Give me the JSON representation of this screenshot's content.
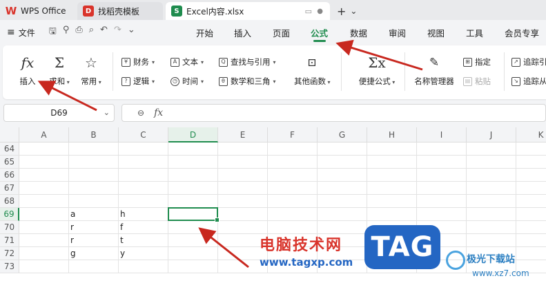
{
  "titlebar": {
    "tabs": [
      {
        "label": "WPS Office",
        "logo": "W"
      },
      {
        "label": "找稻壳模板",
        "logo": "D"
      },
      {
        "label": "Excel内容.xlsx",
        "logo": "S"
      }
    ],
    "add_tab": "+",
    "add_tab_menu": "⌄"
  },
  "menubar": {
    "file": "文件",
    "items": [
      "开始",
      "插入",
      "页面",
      "公式",
      "数据",
      "审阅",
      "视图",
      "工具",
      "会员专享"
    ],
    "active": "公式"
  },
  "ribbon": {
    "insert_fn": "插入",
    "sum": "求和",
    "common": "常用",
    "finance": "财务",
    "text": "文本",
    "lookup": "查找与引用",
    "logic": "逻辑",
    "time": "时间",
    "math": "数学和三角",
    "other": "其他函数",
    "quick": "便捷公式",
    "name_mgr": "名称管理器",
    "specify": "指定",
    "paste": "粘贴",
    "trace1": "追踪引",
    "trace2": "追踪从"
  },
  "formula_bar": {
    "name_box": "D69",
    "fx": "fx",
    "value": ""
  },
  "grid": {
    "columns": [
      "A",
      "B",
      "C",
      "D",
      "E",
      "F",
      "G",
      "H",
      "I",
      "J",
      "K"
    ],
    "selected_column": "D",
    "rows": [
      "64",
      "65",
      "66",
      "67",
      "68",
      "69",
      "70",
      "71",
      "72",
      "73"
    ],
    "selected_row": "69",
    "cells": {
      "B69": "a",
      "C69": "h",
      "B70": "r",
      "C70": "f",
      "B71": "r",
      "C71": "t",
      "B72": "g",
      "C72": "y"
    }
  },
  "watermark": {
    "line1": "电脑技术网",
    "line2": "www.tagxp.com",
    "tag": "TAG",
    "site_name": "极光下载站",
    "site_url": "www.xz7.com"
  },
  "colors": {
    "accent": "#1f8c4e",
    "arrow": "#c8281f",
    "brand_red": "#d9342b",
    "watermark_blue": "#2466c3"
  }
}
